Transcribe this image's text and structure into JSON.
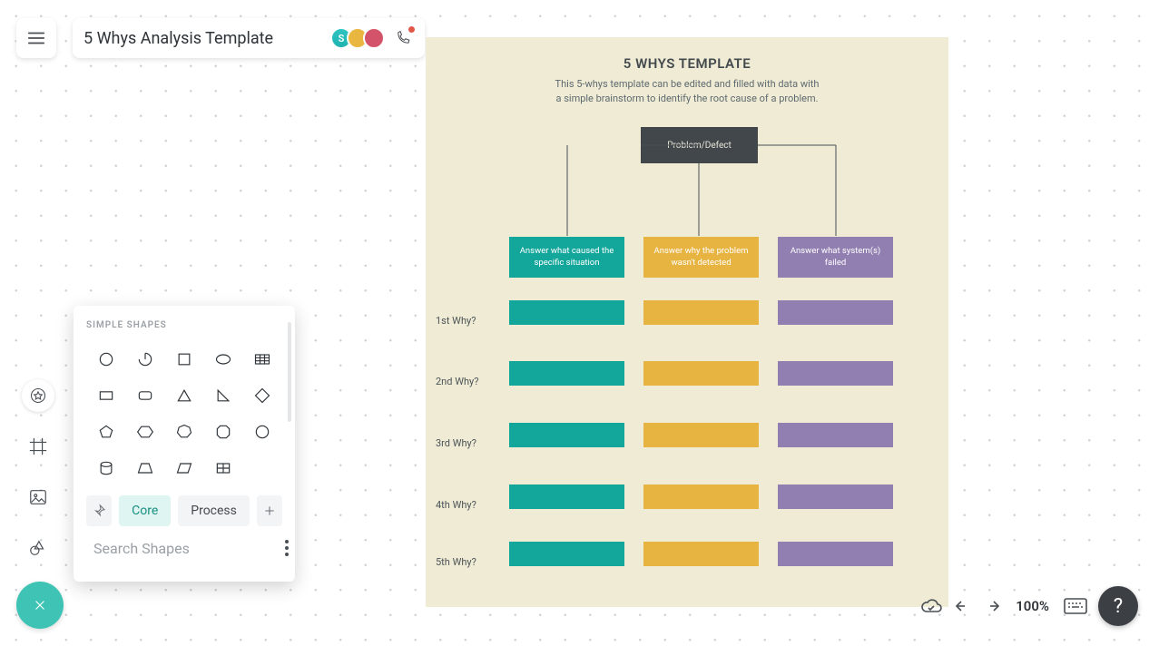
{
  "header": {
    "title": "5 Whys Analysis Template",
    "avatar_initial": "S"
  },
  "canvas": {
    "title": "5 WHYS TEMPLATE",
    "subtitle_line1": "This 5-whys template can be edited and filled with data with",
    "subtitle_line2": "a simple brainstorm to identify the root cause of a problem.",
    "problem": "Problem/Defect",
    "col_headers": [
      "Answer what caused the specific situation",
      "Answer why the problem wasn't detected",
      "Answer what system(s) failed"
    ],
    "rows": [
      "1st Why?",
      "2nd Why?",
      "3rd Why?",
      "4th Why?",
      "5th Why?"
    ],
    "colors": {
      "teal": "#13a69b",
      "gold": "#e8b441",
      "purple": "#927fb1",
      "dark": "#41474b",
      "paper": "#efebd4"
    }
  },
  "shapes_panel": {
    "title": "SIMPLE SHAPES",
    "tabs": [
      "Core",
      "Process"
    ],
    "active_tab": "Core",
    "search_placeholder": "Search Shapes"
  },
  "status": {
    "zoom": "100%"
  },
  "help": "?"
}
